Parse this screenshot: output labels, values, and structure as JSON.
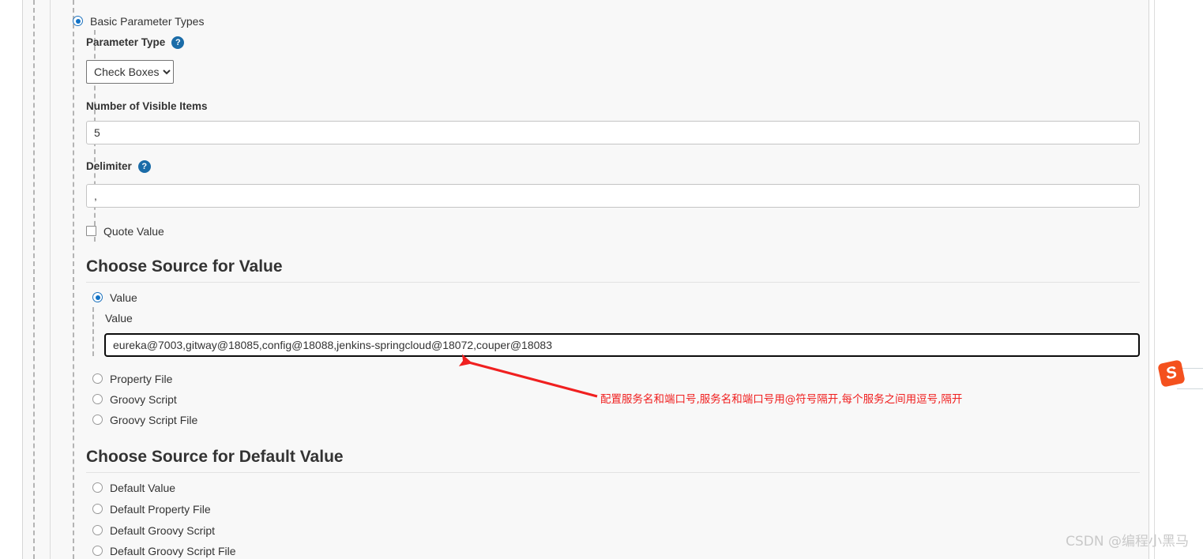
{
  "form": {
    "basic_parameter_types": {
      "label": "Basic Parameter Types",
      "selected": true
    },
    "parameter_type": {
      "label": "Parameter Type",
      "help_icon": "help-icon",
      "value": "Check Boxes",
      "options": [
        "Check Boxes"
      ]
    },
    "number_of_visible_items": {
      "label": "Number of Visible Items",
      "value": "5"
    },
    "delimiter": {
      "label": "Delimiter",
      "help_icon": "help-icon",
      "value": ","
    },
    "quote_value": {
      "label": "Quote Value",
      "checked": false
    }
  },
  "choose_source_for_value": {
    "heading": "Choose Source for Value",
    "options": [
      {
        "label": "Value",
        "selected": true
      },
      {
        "label": "Property File",
        "selected": false
      },
      {
        "label": "Groovy Script",
        "selected": false
      },
      {
        "label": "Groovy Script File",
        "selected": false
      }
    ],
    "value_field": {
      "label": "Value",
      "value": "eureka@7003,gitway@18085,config@18088,jenkins-springcloud@18072,couper@18083",
      "focused": true
    }
  },
  "choose_source_for_default_value": {
    "heading": "Choose Source for Default Value",
    "options": [
      {
        "label": "Default Value",
        "selected": false
      },
      {
        "label": "Default Property File",
        "selected": false
      },
      {
        "label": "Default Groovy Script",
        "selected": false
      },
      {
        "label": "Default Groovy Script File",
        "selected": false
      }
    ]
  },
  "annotation": {
    "text": "配置服务名和端口号,服务名和端口号用@符号隔开,每个服务之间用逗号,隔开",
    "color": "#f02020",
    "arrow": "red-arrow-icon"
  },
  "overlay": {
    "sogou_logo": "sogou-logo-icon",
    "sogou_letter": "S",
    "watermark": "CSDN @编程小黑马"
  },
  "colors": {
    "accent_blue": "#1072c6",
    "help_blue": "#1b6ca8",
    "annotation_red": "#f02020",
    "page_bg": "#f8f8f8",
    "logo_orange": "#f4511e"
  }
}
